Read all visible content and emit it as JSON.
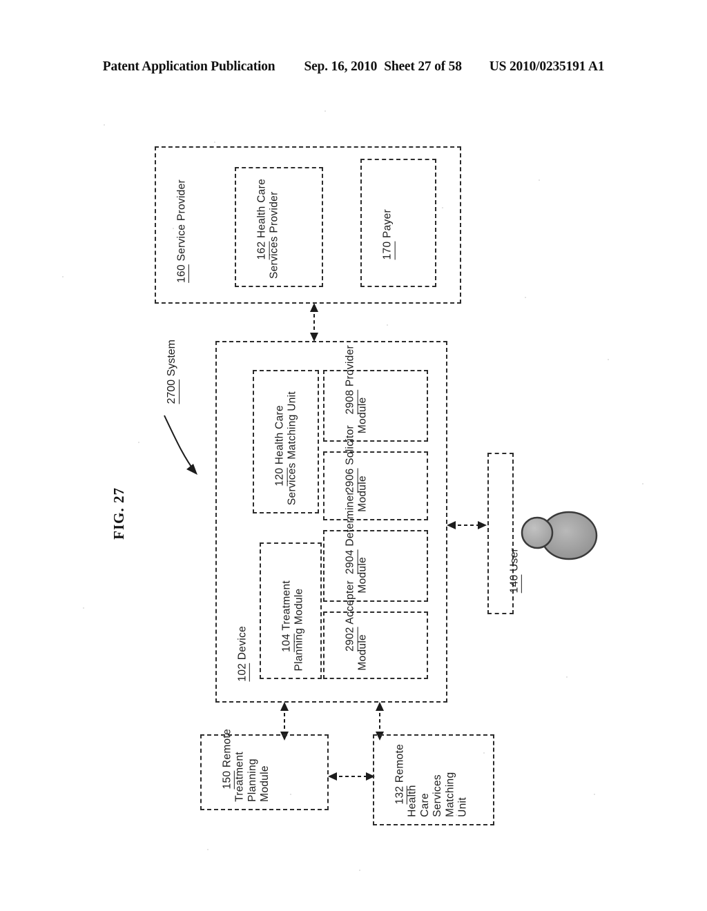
{
  "header": {
    "publication": "Patent Application Publication",
    "date": "Sep. 16, 2010",
    "sheet": "Sheet 27 of 58",
    "patent_number": "US 2010/0235191 A1"
  },
  "figure": {
    "label": "FIG. 27"
  },
  "system_callout": {
    "number": "2700",
    "name": " System"
  },
  "blocks": {
    "service_provider": {
      "number": "160",
      "name": " Service Provider"
    },
    "health_care_services_provider": {
      "number": "162",
      "name": " Health Care\nServices Provider"
    },
    "payer": {
      "number": "170",
      "name": " Payer"
    },
    "device": {
      "number": "102",
      "name": " Device"
    },
    "treatment_planning_module": {
      "number": "104",
      "name": " Treatment\nPlanning Module"
    },
    "health_care_services_matching_unit": {
      "number": "120",
      "name": " Health Care\nServices Matching Unit"
    },
    "accepter_module": {
      "number": "2902",
      "name": " Accepter\nModule"
    },
    "determiner_module": {
      "number": "2904",
      "name": " Determiner\nModule"
    },
    "solicitor_module": {
      "number": "2906",
      "name": " Solicitor\nModule"
    },
    "provider_module": {
      "number": "2908",
      "name": " Provider\nModule"
    },
    "user": {
      "number": "140",
      "name": " User"
    },
    "remote_treatment_planning_module": {
      "number": "150",
      "name": " Remote\nTreatment\nPlanning\nModule"
    },
    "remote_health_care_services_matching_unit": {
      "number": "132",
      "name": " Remote\nHealth\nCare\nServices\nMatching\nUnit"
    }
  },
  "colors": {
    "ink": "#1c1c1c",
    "border": "#2b2b2b",
    "page": "#ffffff",
    "silhouette_fill": "#9a9a9a",
    "silhouette_stroke": "#3a3a3a"
  }
}
